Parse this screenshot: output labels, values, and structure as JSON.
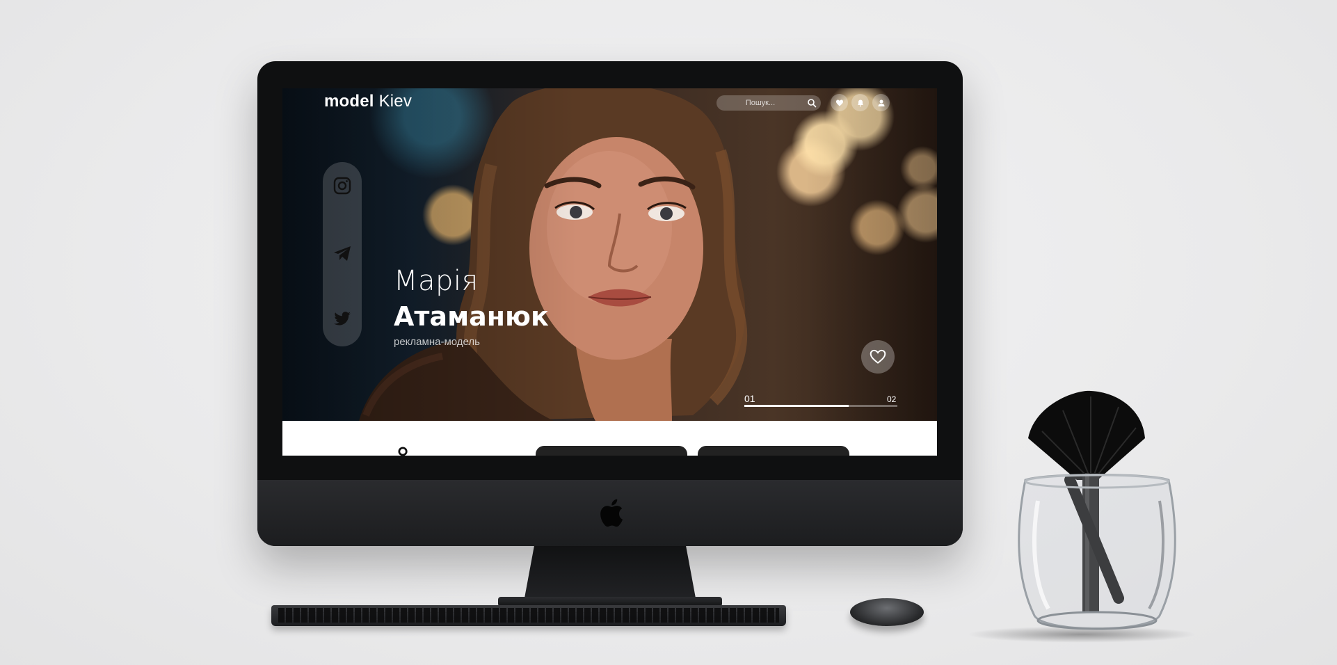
{
  "site": {
    "brand_bold": "model",
    "brand_light": "Kiev",
    "search_placeholder": "Пошук...",
    "profile": {
      "first_name": "Марія",
      "last_name": "Атаманюк",
      "role": "рекламна-модель"
    },
    "slider": {
      "current": "01",
      "total": "02",
      "progress": 0.68
    }
  },
  "icons": {
    "header": [
      "heart-icon",
      "bell-icon",
      "user-icon"
    ],
    "social": [
      "instagram-icon",
      "telegram-icon",
      "twitter-icon"
    ]
  },
  "colors": {
    "screen_text": "#ffffff",
    "device": "#0f1011",
    "background": "#ececed"
  }
}
